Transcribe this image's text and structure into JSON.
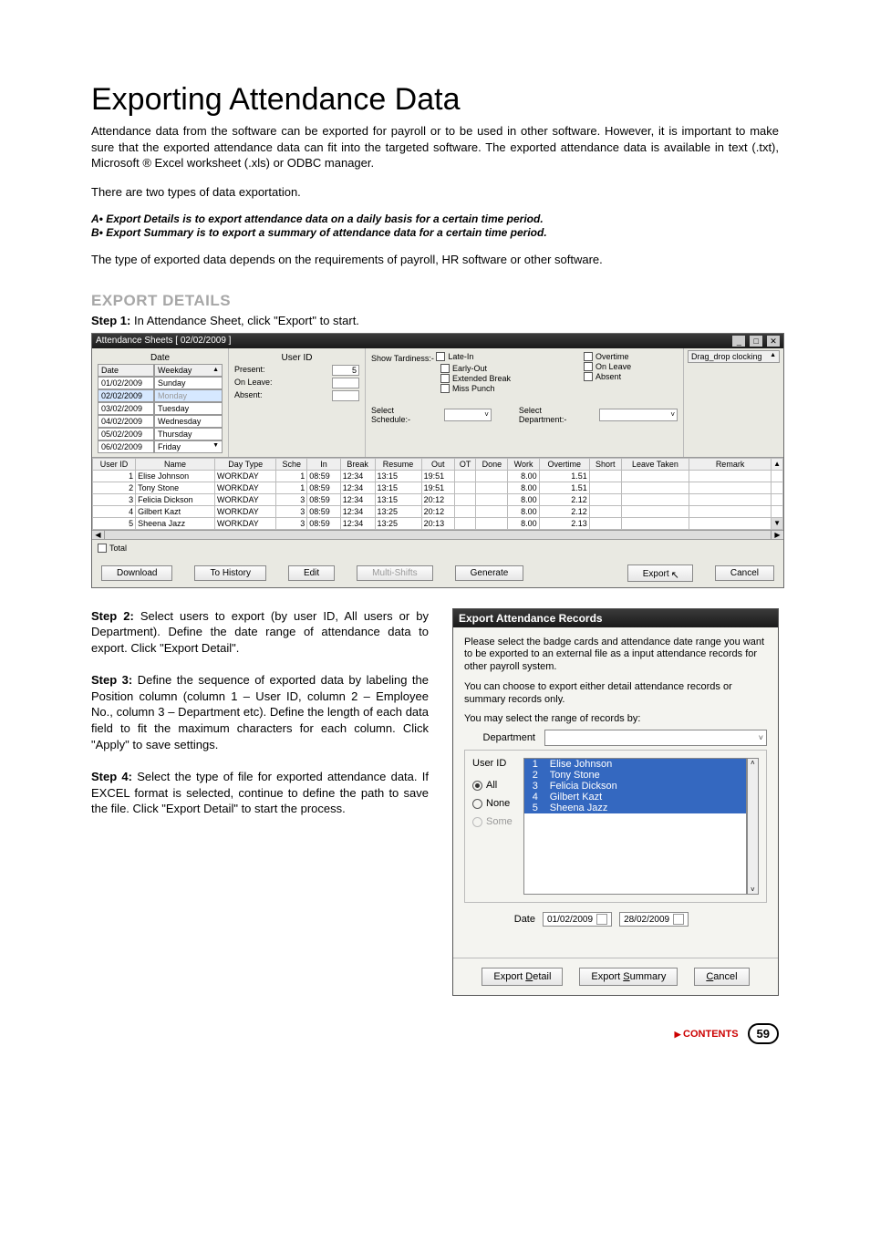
{
  "page": {
    "title": "Exporting Attendance Data",
    "intro": "Attendance data from the software can be exported for payroll or to be used in other software. However, it is important to make sure that the exported attendance data can fit into the targeted software. The exported attendance data is available in text (.txt), Microsoft ® Excel worksheet (.xls) or ODBC manager.",
    "two_types": "There are two types of data exportation.",
    "bullet_a": "A•  Export Details is to export attendance data on a daily basis for a certain time period.",
    "bullet_b": "B•  Export Summary is to export a summary of attendance data for a certain time period.",
    "depends": "The type of exported data depends on the requirements of payroll, HR software or other software.",
    "section_heading": "EXPORT DETAILS",
    "step1_label": "Step 1:",
    "step1_text": " In Attendance Sheet, click \"Export\" to start.",
    "contents_link": "CONTENTS",
    "page_number": "59"
  },
  "win1": {
    "title": "Attendance Sheets   [ 02/02/2009 ]",
    "date_label": "Date",
    "userid_label": "User ID",
    "drag_label": "Drag_drop clocking",
    "date_col_headers": [
      "Date",
      "Weekday"
    ],
    "date_rows": [
      [
        "01/02/2009",
        "Sunday"
      ],
      [
        "02/02/2009",
        "Monday"
      ],
      [
        "03/02/2009",
        "Tuesday"
      ],
      [
        "04/02/2009",
        "Wednesday"
      ],
      [
        "05/02/2009",
        "Thursday"
      ],
      [
        "06/02/2009",
        "Friday"
      ]
    ],
    "stats": [
      [
        "Present:",
        "5"
      ],
      [
        "On Leave:",
        ""
      ],
      [
        "Absent:",
        ""
      ]
    ],
    "tardiness_label": "Show Tardiness:-",
    "checks_col1": [
      "Late-In",
      "Early-Out",
      "Extended Break",
      "Miss Punch"
    ],
    "checks_col2": [
      "Overtime",
      "On Leave",
      "Absent"
    ],
    "select_schedule": "Select Schedule:-",
    "select_department": "Select Department:-",
    "grid_headers": [
      "User ID",
      "Name",
      "Day Type",
      "Sche",
      "In",
      "Break",
      "Resume",
      "Out",
      "OT",
      "Done",
      "Work",
      "Overtime",
      "Short",
      "Leave Taken",
      "Remark"
    ],
    "grid_rows": [
      [
        "1",
        "Elise Johnson",
        "WORKDAY",
        "1",
        "08:59",
        "12:34",
        "13:15",
        "19:51",
        "",
        "",
        "8.00",
        "1.51",
        "",
        "",
        ""
      ],
      [
        "2",
        "Tony Stone",
        "WORKDAY",
        "1",
        "08:59",
        "12:34",
        "13:15",
        "19:51",
        "",
        "",
        "8.00",
        "1.51",
        "",
        "",
        ""
      ],
      [
        "3",
        "Felicia Dickson",
        "WORKDAY",
        "3",
        "08:59",
        "12:34",
        "13:15",
        "20:12",
        "",
        "",
        "8.00",
        "2.12",
        "",
        "",
        ""
      ],
      [
        "4",
        "Gilbert Kazt",
        "WORKDAY",
        "3",
        "08:59",
        "12:34",
        "13:25",
        "20:12",
        "",
        "",
        "8.00",
        "2.12",
        "",
        "",
        ""
      ],
      [
        "5",
        "Sheena Jazz",
        "WORKDAY",
        "3",
        "08:59",
        "12:34",
        "13:25",
        "20:13",
        "",
        "",
        "8.00",
        "2.13",
        "",
        "",
        ""
      ]
    ],
    "total_label": "Total",
    "buttons": {
      "download": "Download",
      "to_history": "To History",
      "edit": "Edit",
      "multi_shifts": "Multi-Shifts",
      "generate": "Generate",
      "export": "Export",
      "cancel": "Cancel"
    }
  },
  "steps": {
    "s2_b": "Step 2:",
    "s2": " Select users to export (by user ID, All users or by Department). Define the date range of attendance data to export. Click \"Export Detail\".",
    "s3_b": "Step 3:",
    "s3": " Define the sequence of exported data by labeling the Position column (column 1 – User ID, column 2 – Employee No., column 3 – Department etc). Define the length of each data field to fit the maximum characters for each column. Click \"Apply\" to save settings.",
    "s4_b": "Step 4:",
    "s4": " Select the type of file for exported attendance data. If EXCEL format is selected, continue to define the path to save the file. Click \"Export Detail\" to start the process."
  },
  "dlg": {
    "title": "Export Attendance Records",
    "para1": "Please select the badge cards and attendance date range you want to be exported to an external file as a input attendance records for other payroll system.",
    "para2": "You can choose to export either detail attendance records or summary records only.",
    "select_by": "You may select the range of records by:",
    "department_lbl": "Department",
    "userid_lbl": "User ID",
    "radio_all": "All",
    "radio_none": "None",
    "radio_some": "Some",
    "users": [
      [
        "1",
        "Elise Johnson"
      ],
      [
        "2",
        "Tony Stone"
      ],
      [
        "3",
        "Felicia Dickson"
      ],
      [
        "4",
        "Gilbert Kazt"
      ],
      [
        "5",
        "Sheena Jazz"
      ]
    ],
    "date_lbl": "Date",
    "date_from": "01/02/2009",
    "date_to": "28/02/2009",
    "btn_detail_pre": "Export ",
    "btn_detail_u": "D",
    "btn_detail_post": "etail",
    "btn_summary_pre": "Export ",
    "btn_summary_u": "S",
    "btn_summary_post": "ummary",
    "btn_cancel_u": "C",
    "btn_cancel_post": "ancel"
  }
}
